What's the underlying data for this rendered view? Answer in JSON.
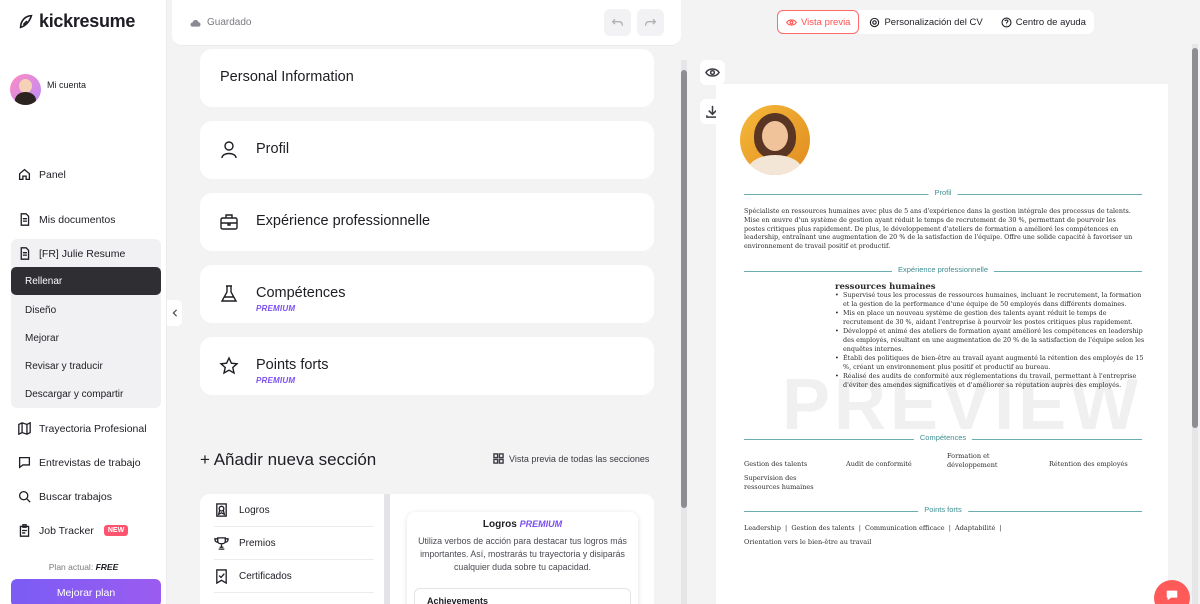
{
  "app": {
    "logo_text": "kickresume",
    "account_label": "Mi cuenta"
  },
  "sidebar": {
    "panel": "Panel",
    "my_documents": "Mis documentos",
    "document_name": "[FR] Julie Resume",
    "sub_items": [
      "Rellenar",
      "Diseño",
      "Mejorar",
      "Revisar y traducir",
      "Descargar y compartir"
    ],
    "career_path": "Trayectoria Profesional",
    "interviews": "Entrevistas de trabajo",
    "job_search": "Buscar trabajos",
    "job_tracker": "Job Tracker",
    "new_badge": "NEW",
    "plan_prefix": "Plan actual:",
    "plan_name": "FREE",
    "upgrade_button": "Mejorar plan"
  },
  "editor": {
    "saved_status": "Guardado",
    "sections": [
      {
        "title": "Personal Information",
        "premium": ""
      },
      {
        "title": "Profil",
        "premium": ""
      },
      {
        "title": "Expérience professionnelle",
        "premium": ""
      },
      {
        "title": "Compétences",
        "premium": "PREMIUM"
      },
      {
        "title": "Points forts",
        "premium": "PREMIUM"
      }
    ],
    "add_section_title": "+ Añadir nueva sección",
    "preview_all_link": "Vista previa de todas las secciones",
    "add_options": [
      "Logros",
      "Premios",
      "Certificados"
    ],
    "add_preview": {
      "title": "Logros",
      "premium": "PREMIUM",
      "description": "Utiliza verbos de acción para destacar tus logros más importantes. Así, mostrarás tu trayectoria y disiparás cualquier duda sobre tu capacidad.",
      "sub_title": "Achievements"
    }
  },
  "preview": {
    "tabs": [
      "Vista previa",
      "Personalización del CV",
      "Centro de ayuda"
    ],
    "resume": {
      "profile_heading": "Profil",
      "profile_text": "Spécialiste en ressources humaines avec plus de 5 ans d'expérience dans la gestion intégrale des processus de talents. Mise en œuvre d'un système de gestion ayant réduit le temps de recrutement de 30 %, permettant de pourvoir les postes critiques plus rapidement. De plus, le développement d'ateliers de formation a amélioré les compétences en leadership, entraînant une augmentation de 20 % de la satisfaction de l'équipe. Offre une solide capacité à favoriser un environnement de travail positif et productif.",
      "experience_heading": "Expérience professionnelle",
      "experience_title": "ressources humaines",
      "experience_bullets": [
        "Supervisé tous les processus de ressources humaines, incluant le recrutement, la formation et la gestion de la performance d'une équipe de 50 employés dans différents domaines.",
        "Mis en place un nouveau système de gestion des talents ayant réduit le temps de recrutement de 30 %, aidant l'entreprise à pourvoir les postes critiques plus rapidement.",
        "Développé et animé des ateliers de formation ayant amélioré les compétences en leadership des employés, résultant en une augmentation de 20 % de la satisfaction de l'équipe selon les enquêtes internes.",
        "Établi des politiques de bien-être au travail ayant augmenté la rétention des employés de 15 %, créant un environnement plus positif et productif au bureau.",
        "Réalisé des audits de conformité aux réglementations du travail, permettant à l'entreprise d'éviter des amendes significatives et d'améliorer sa réputation auprès des employés."
      ],
      "watermark": "PREVIEW",
      "skills_heading": "Compétences",
      "skills": [
        "Gestion des talents",
        "Audit de conformité",
        "Formation et développement",
        "Rétention des employés",
        "Supervision des ressources humaines"
      ],
      "strengths_heading": "Points forts",
      "strengths_line1": "Leadership  |  Gestion des talents  |  Communication efficace  |  Adaptabilité  |",
      "strengths_line2": "Orientation vers le bien-être au travail"
    }
  },
  "colors": {
    "accent_purple": "#7b4ff0",
    "accent_red": "#ff5050",
    "resume_teal": "#3f8f92",
    "active_dark": "#2e2e33"
  }
}
